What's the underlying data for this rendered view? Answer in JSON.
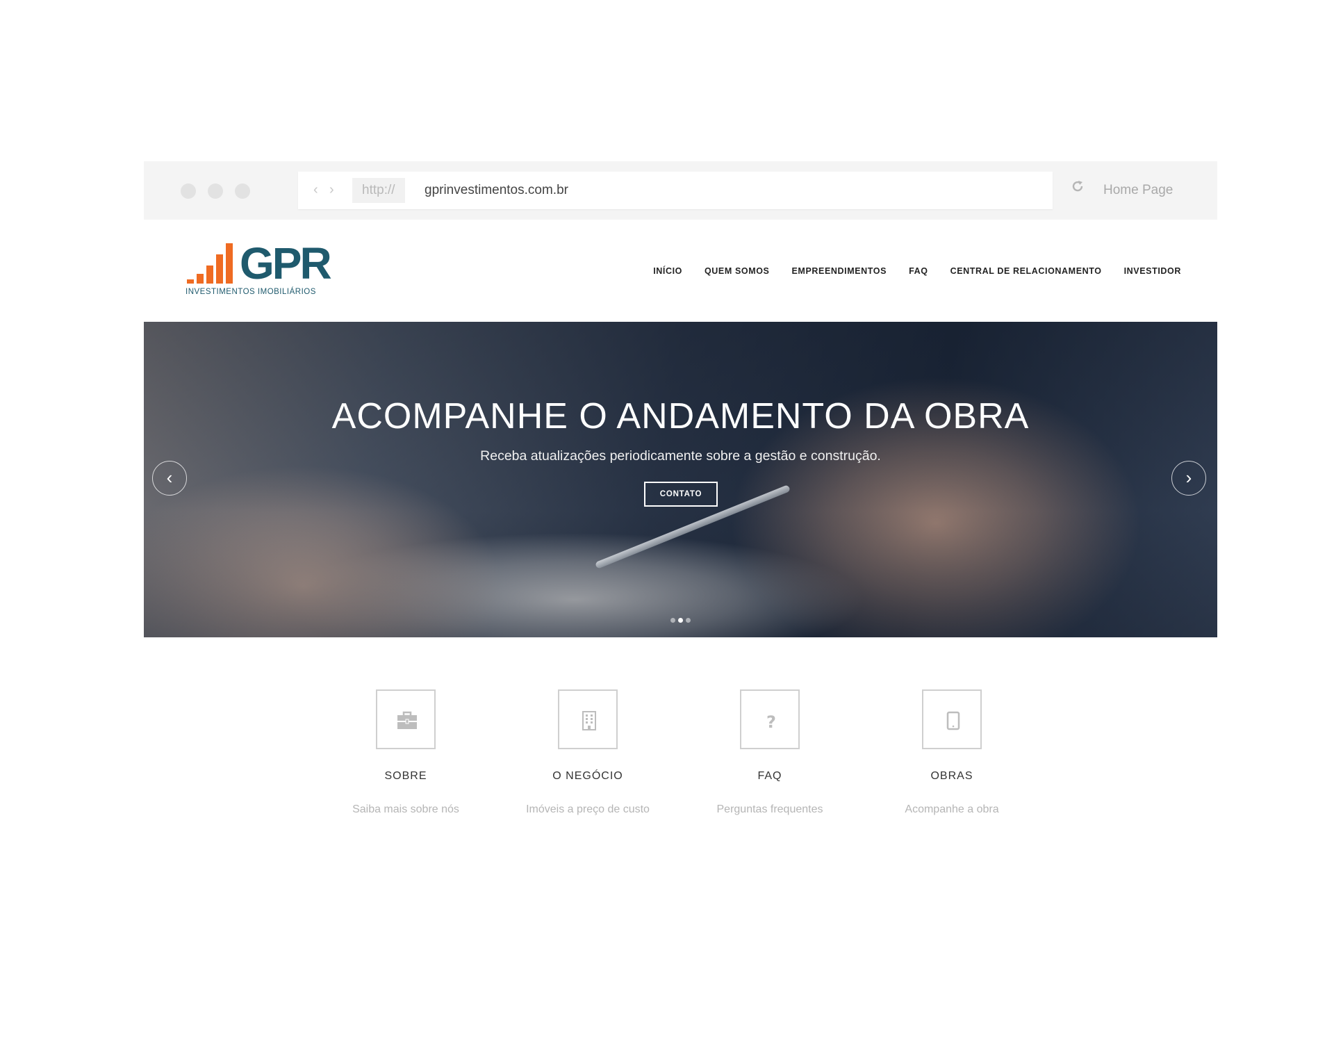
{
  "browser": {
    "protocol": "http://",
    "url": "gprinvestimentos.com.br",
    "home_label": "Home Page"
  },
  "logo": {
    "text": "GPR",
    "tagline": "INVESTIMENTOS IMOBILIÁRIOS",
    "bar_color": "#ef6b22",
    "text_color": "#1f5a6d"
  },
  "nav": {
    "items": [
      {
        "label": "INÍCIO"
      },
      {
        "label": "QUEM SOMOS"
      },
      {
        "label": "EMPREENDIMENTOS"
      },
      {
        "label": "FAQ"
      },
      {
        "label": "CENTRAL DE RELACIONAMENTO"
      },
      {
        "label": "INVESTIDOR"
      }
    ]
  },
  "hero": {
    "title": "ACOMPANHE O ANDAMENTO DA OBRA",
    "subtitle": "Receba atualizações periodicamente sobre a gestão e construção.",
    "button_label": "CONTATO",
    "prev_icon": "‹",
    "next_icon": "›",
    "slides_count": 3,
    "active_slide": 2
  },
  "features": [
    {
      "icon": "briefcase-icon",
      "title": "SOBRE",
      "desc": "Saiba mais sobre nós"
    },
    {
      "icon": "building-icon",
      "title": "O NEGÓCIO",
      "desc": "Imóveis a preço de custo"
    },
    {
      "icon": "question-icon",
      "title": "FAQ",
      "desc": "Perguntas frequentes"
    },
    {
      "icon": "tablet-icon",
      "title": "OBRAS",
      "desc": "Acompanhe a obra"
    }
  ]
}
